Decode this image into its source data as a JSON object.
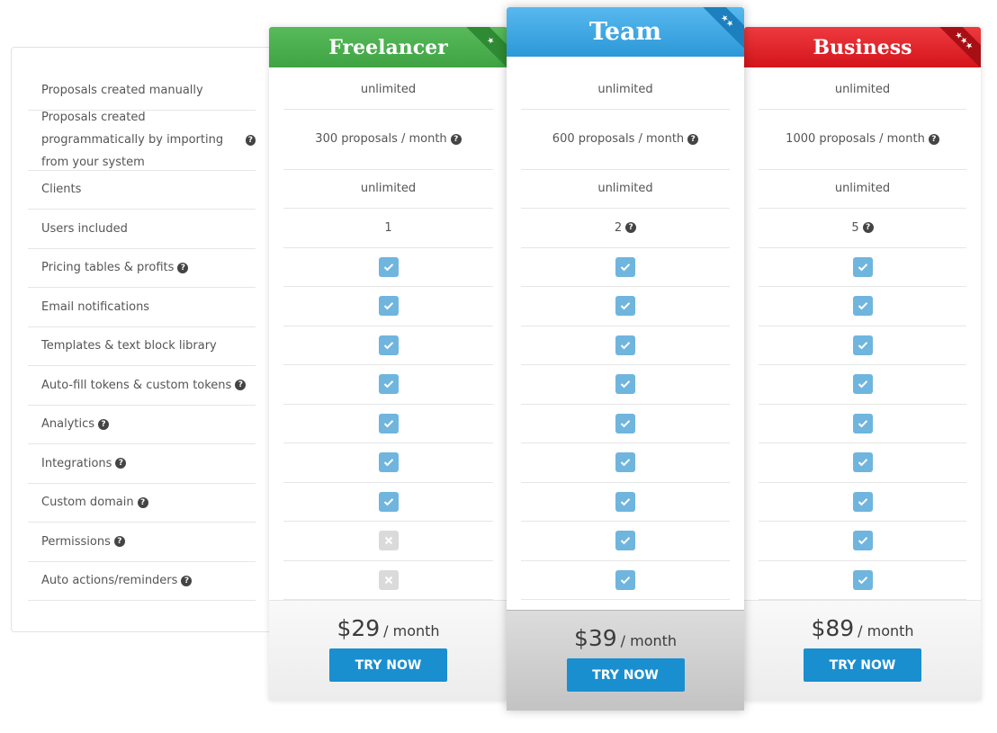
{
  "features": [
    {
      "label": "Proposals created manually",
      "help": false
    },
    {
      "label": "Proposals created programmatically by importing from your system",
      "help": true
    },
    {
      "label": "Clients",
      "help": false
    },
    {
      "label": "Users included",
      "help": false
    },
    {
      "label": "Pricing tables & profits",
      "help": true
    },
    {
      "label": "Email notifications",
      "help": false
    },
    {
      "label": "Templates & text block library",
      "help": false
    },
    {
      "label": "Auto-fill tokens & custom tokens",
      "help": true
    },
    {
      "label": "Analytics",
      "help": true
    },
    {
      "label": "Integrations",
      "help": true
    },
    {
      "label": "Custom domain",
      "help": true
    },
    {
      "label": "Permissions",
      "help": true
    },
    {
      "label": "Auto actions/reminders",
      "help": true
    }
  ],
  "plans": [
    {
      "name": "Freelancer",
      "stars": "★",
      "color": "#4caf50",
      "values": [
        {
          "text": "unlimited"
        },
        {
          "text": "300 proposals / month",
          "help": true
        },
        {
          "text": "unlimited"
        },
        {
          "text": "1"
        },
        {
          "check": true
        },
        {
          "check": true
        },
        {
          "check": true
        },
        {
          "check": true
        },
        {
          "check": true
        },
        {
          "check": true
        },
        {
          "check": true
        },
        {
          "check": false
        },
        {
          "check": false
        }
      ],
      "price": "$29",
      "period": "/ month",
      "cta": "TRY NOW"
    },
    {
      "name": "Team",
      "stars": "★★",
      "color": "#3aa5e4",
      "values": [
        {
          "text": "unlimited"
        },
        {
          "text": "600 proposals / month",
          "help": true
        },
        {
          "text": "unlimited"
        },
        {
          "text": "2",
          "help": true
        },
        {
          "check": true
        },
        {
          "check": true
        },
        {
          "check": true
        },
        {
          "check": true
        },
        {
          "check": true
        },
        {
          "check": true
        },
        {
          "check": true
        },
        {
          "check": true
        },
        {
          "check": true
        }
      ],
      "price": "$39",
      "period": "/ month",
      "cta": "TRY NOW"
    },
    {
      "name": "Business",
      "stars": "★★★",
      "color": "#e2262c",
      "values": [
        {
          "text": "unlimited"
        },
        {
          "text": "1000 proposals / month",
          "help": true
        },
        {
          "text": "unlimited"
        },
        {
          "text": "5",
          "help": true
        },
        {
          "check": true
        },
        {
          "check": true
        },
        {
          "check": true
        },
        {
          "check": true
        },
        {
          "check": true
        },
        {
          "check": true
        },
        {
          "check": true
        },
        {
          "check": true
        },
        {
          "check": true
        }
      ],
      "price": "$89",
      "period": "/ month",
      "cta": "TRY NOW"
    }
  ],
  "icons": {
    "help": "?",
    "check": "check-icon",
    "cross": "x-icon"
  }
}
